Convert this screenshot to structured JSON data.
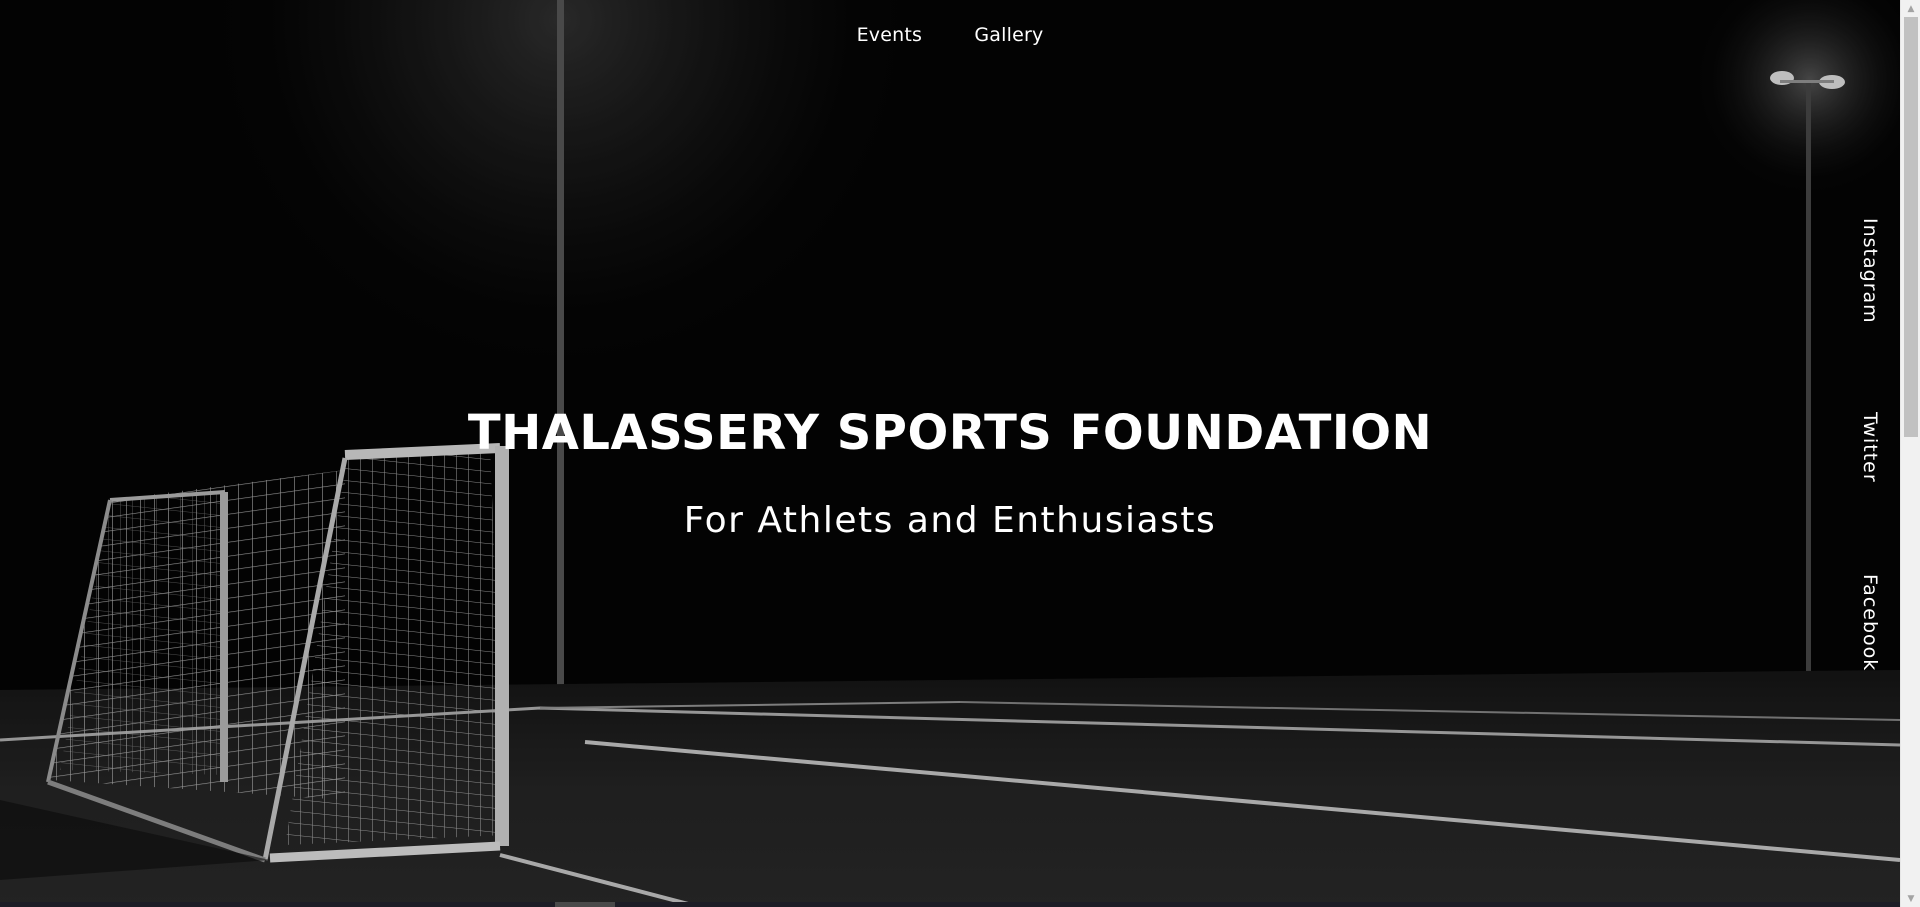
{
  "nav": {
    "items": [
      {
        "label": "Events"
      },
      {
        "label": "Gallery"
      }
    ]
  },
  "hero": {
    "title": "THALASSERY SPORTS FOUNDATION",
    "subtitle": "For Athlets and Enthusiasts",
    "background_icon": "soccer-field-night-photo"
  },
  "social": {
    "instagram": "Instagram",
    "twitter": "Twitter",
    "facebook": "Facebook"
  },
  "colors": {
    "text": "#ffffff",
    "background": "#030303",
    "scrollbar_track": "#f1f1f1",
    "scrollbar_thumb": "#c1c1c1"
  }
}
